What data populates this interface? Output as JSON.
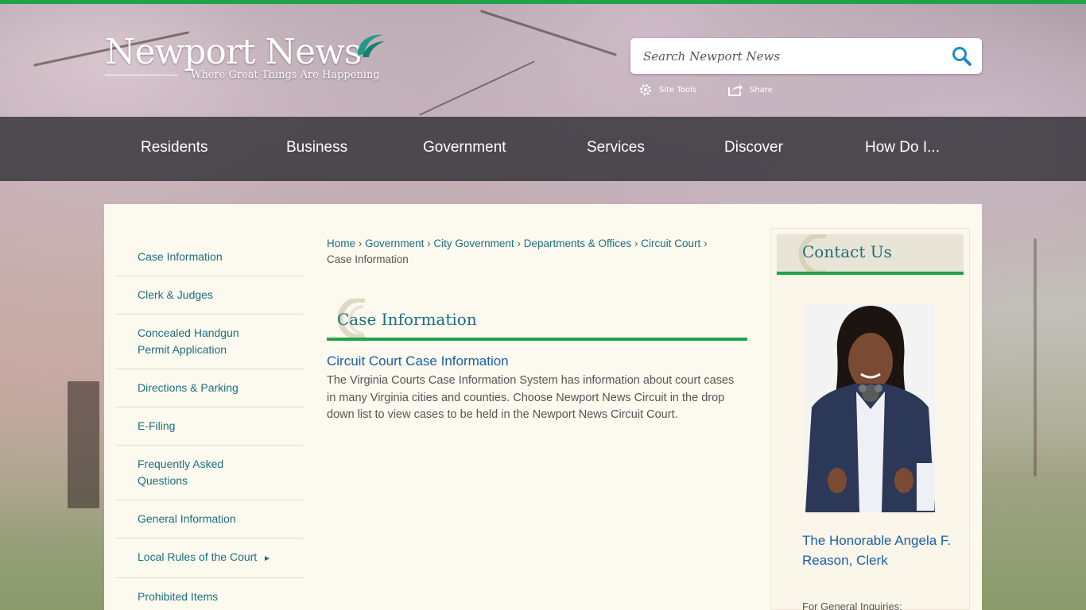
{
  "header": {
    "logo_title": "Newport News",
    "logo_tagline": "Where Great Things Are Happening",
    "search_placeholder": "Search Newport News",
    "site_tools_label": "Site Tools",
    "share_label": "Share"
  },
  "nav": {
    "items": [
      {
        "label": "Residents"
      },
      {
        "label": "Business"
      },
      {
        "label": "Government"
      },
      {
        "label": "Services"
      },
      {
        "label": "Discover"
      },
      {
        "label": "How Do I..."
      }
    ]
  },
  "sidebar": {
    "items": [
      {
        "label": "Case Information"
      },
      {
        "label": "Clerk & Judges"
      },
      {
        "label": "Concealed Handgun Permit Application"
      },
      {
        "label": "Directions & Parking"
      },
      {
        "label": "E-Filing"
      },
      {
        "label": "Frequently Asked Questions"
      },
      {
        "label": "General Information"
      },
      {
        "label": "Local Rules of the Court",
        "arrow": "►"
      },
      {
        "label": "Prohibited Items"
      }
    ]
  },
  "breadcrumb": {
    "items": [
      "Home",
      "Government",
      "City Government",
      "Departments & Offices",
      "Circuit Court"
    ],
    "current": "Case Information",
    "separator": "›"
  },
  "main": {
    "heading": "Case Information",
    "article_link": "Circuit Court Case Information",
    "article_body": "The Virginia Courts Case Information System has information about court cases in many Virginia cities and counties. Choose Newport News Circuit in the drop down list to view cases to be held in the Newport News Circuit Court."
  },
  "contact": {
    "title": "Contact Us",
    "name": "The Honorable Angela F. Reason, Clerk",
    "sub": "For General Inquiries:"
  },
  "colors": {
    "accent_green": "#1ea34a",
    "teal_link": "#1b6f7d",
    "blue_link": "#1b5fa8"
  }
}
